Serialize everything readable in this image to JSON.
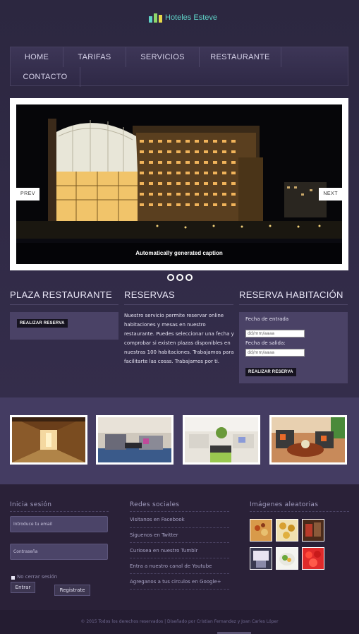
{
  "brand": {
    "name": "Hoteles Esteve",
    "accent": "#5fd3c7"
  },
  "nav": {
    "items": [
      {
        "label": "HOME"
      },
      {
        "label": "TARIFAS"
      },
      {
        "label": "SERVICIOS"
      },
      {
        "label": "RESTAURANTE"
      },
      {
        "label": "CONTACTO"
      }
    ]
  },
  "slider": {
    "caption": "Automatically generated caption",
    "prev_label": "PREV",
    "next_label": "NEXT",
    "dots": 3
  },
  "plaza": {
    "title": "PLAZA RESTAURANTE",
    "button_label": "REALIZAR RESERVA"
  },
  "reservas": {
    "title": "RESERVAS",
    "text": "Nuestro servicio permite reservar online habitaciones y mesas en nuestro restaurante. Puedes seleccionar una fecha y comprobar si existen plazas disponibles en nuestras 100 habitaciones. Trabajamos para facilitarte las cosas. Trabajamos por ti."
  },
  "habitacion": {
    "title": "RESERVA HABITACIÓN",
    "checkin_label": "Fecha de entrada",
    "checkin_placeholder": "dd/mm/aaaa",
    "checkout_label": "Fecha de salida:",
    "checkout_placeholder": "dd/mm/aaaa",
    "button_label": "REALIZAR RESERVA"
  },
  "gallery": {
    "images": [
      {
        "icon": "hotel-corridor-photo"
      },
      {
        "icon": "hotel-lounge-photo"
      },
      {
        "icon": "hotel-sitting-room-photo"
      },
      {
        "icon": "hotel-living-room-photo"
      }
    ]
  },
  "footer": {
    "login": {
      "title": "Inicia sesión",
      "email_placeholder": "Introduce tu email",
      "password_placeholder": "Contraseña",
      "remember_label": "No cerrar sesión",
      "login_button": "Entrar",
      "register_button": "Registrate"
    },
    "social": {
      "title": "Redes sociales",
      "links": [
        {
          "label": "Visitanos en Facebook"
        },
        {
          "label": "Siguenos en Twitter"
        },
        {
          "label": "Curiosea en nuestro Tumblr"
        },
        {
          "label": "Entra a nuestro canal de Youtube"
        },
        {
          "label": "Agreganos a tus circulos en Google+"
        }
      ]
    },
    "random": {
      "title": "Imágenes aleatorias",
      "images": [
        {
          "icon": "food-photo-1"
        },
        {
          "icon": "food-photo-2"
        },
        {
          "icon": "food-photo-3"
        },
        {
          "icon": "food-photo-4"
        },
        {
          "icon": "food-photo-5"
        },
        {
          "icon": "food-photo-6"
        }
      ]
    },
    "copyright": "© 2015 Todos los derechos reservados | Diseñado por Cristian Fernandez y Joan Carles Lóper"
  }
}
